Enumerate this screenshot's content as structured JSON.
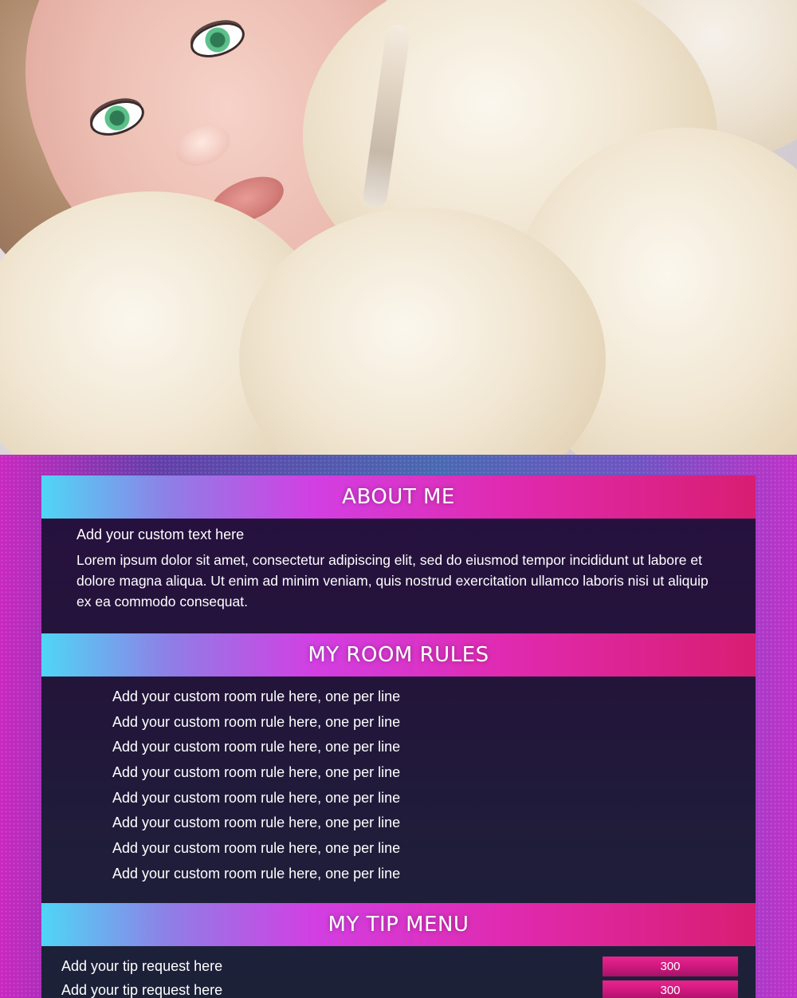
{
  "colors": {
    "header_gradient_start": "#4fd6f5",
    "header_gradient_mid": "#d23fe3",
    "header_gradient_end": "#d81e72",
    "content_background": "#27103f",
    "tip_price_background": "#c8177a",
    "text": "#ffffff"
  },
  "hero": {
    "icon": "portrait-photo-icon"
  },
  "about": {
    "title": "ABOUT ME",
    "subtitle": "Add your custom text here",
    "text": "Lorem ipsum dolor sit amet, consectetur adipiscing elit, sed do eiusmod tempor incididunt ut labore et dolore magna aliqua. Ut enim ad minim veniam, quis nostrud exercitation ullamco laboris nisi ut aliquip ex ea commodo consequat."
  },
  "rules": {
    "title": "MY ROOM RULES",
    "items": [
      "Add your custom room rule here, one per line",
      "Add your custom room rule here, one per line",
      "Add your custom room rule here, one per line",
      "Add your custom room rule here, one per line",
      "Add your custom room rule here, one per line",
      "Add your custom room rule here, one per line",
      "Add your custom room rule here, one per line",
      "Add your custom room rule here, one per line"
    ]
  },
  "tips": {
    "title": "MY TIP MENU",
    "items": [
      {
        "label": "Add your tip request here",
        "price": "300"
      },
      {
        "label": "Add your tip request here",
        "price": "300"
      }
    ]
  }
}
